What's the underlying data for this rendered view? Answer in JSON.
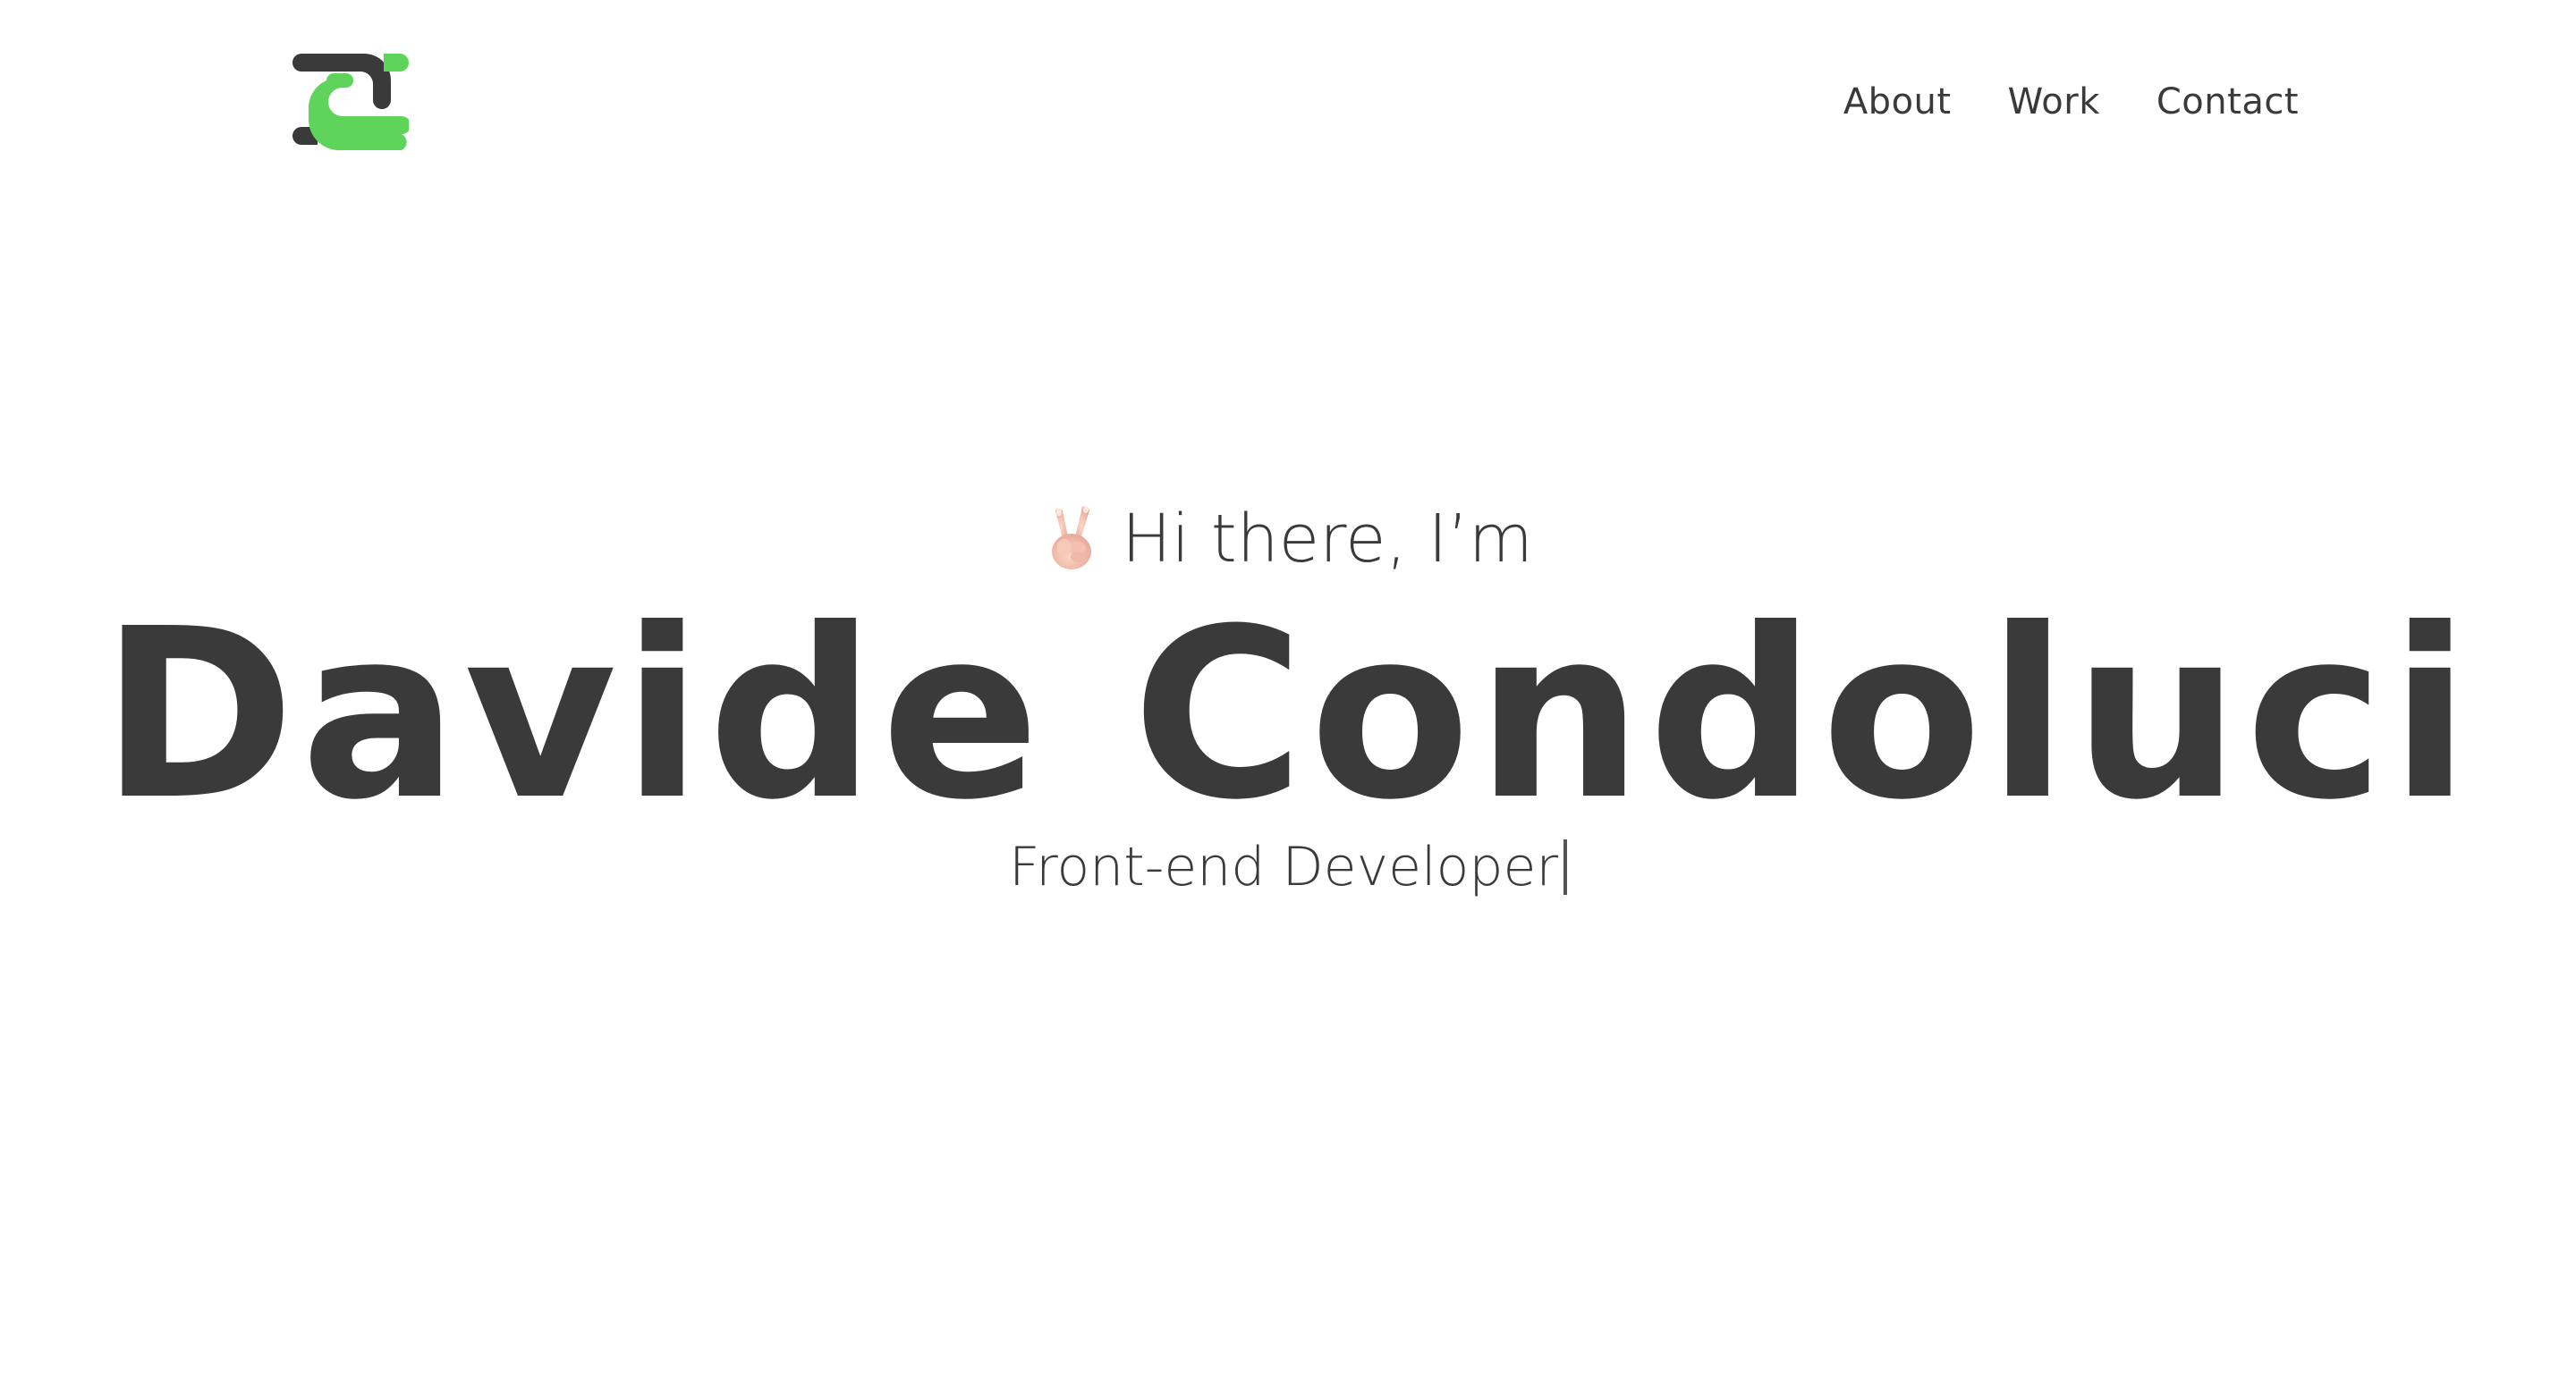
{
  "header": {
    "logo_icon": "dc-monogram-logo",
    "nav": [
      {
        "label": "About"
      },
      {
        "label": "Work"
      },
      {
        "label": "Contact"
      }
    ]
  },
  "hero": {
    "greeting_emoji": "victory-hand-emoji",
    "greeting": "Hi there, I’m",
    "name": "Davide Condoluci",
    "role": "Front-end Developer"
  },
  "colors": {
    "text": "#3a3a3a",
    "accent": "#5ed45a",
    "background": "#ffffff"
  }
}
